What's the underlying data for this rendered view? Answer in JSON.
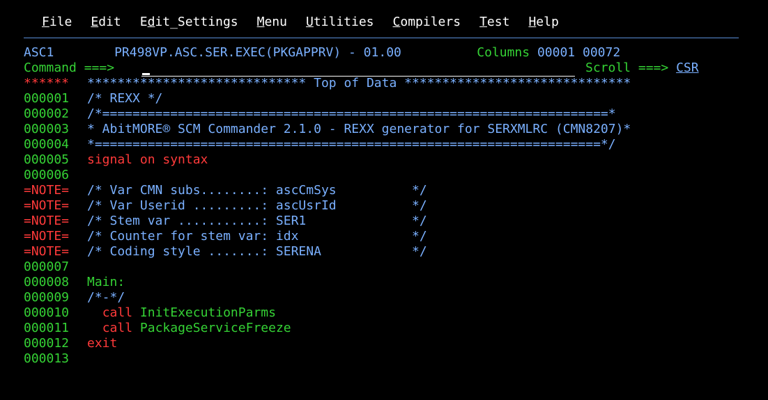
{
  "menu": {
    "items": [
      {
        "hot": "F",
        "rest": "ile"
      },
      {
        "hot": "E",
        "rest": "dit"
      },
      {
        "hot": "",
        "rest": "Edit_Settings",
        "hot_index": 1
      },
      {
        "hot": "M",
        "rest": "enu"
      },
      {
        "hot": "U",
        "rest": "tilities"
      },
      {
        "hot": "C",
        "rest": "ompilers"
      },
      {
        "hot": "T",
        "rest": "est"
      },
      {
        "hot": "H",
        "rest": "elp"
      }
    ],
    "labels": {
      "file_hot": "F",
      "file_rest": "ile",
      "edit_hot": "E",
      "edit_rest": "dit",
      "editset_pre": "E",
      "editset_hot": "d",
      "editset_rest": "it_Settings",
      "menu_hot": "M",
      "menu_rest": "enu",
      "util_hot": "U",
      "util_rest": "tilities",
      "comp_hot": "C",
      "comp_rest": "ompilers",
      "test_hot": "T",
      "test_rest": "est",
      "help_hot": "H",
      "help_rest": "elp"
    }
  },
  "header": {
    "mode": "ASC1",
    "dataset": "PR498VP.ASC.SER.EXEC(PKGAPPRV) - 01.00",
    "columns_label": "Columns",
    "columns_from": "00001",
    "columns_to": "00072",
    "command_label": "Command ===>",
    "command_value": "",
    "scroll_label": "Scroll ===>",
    "scroll_value": "CSR"
  },
  "editor": {
    "top_marker": "******",
    "top_line": "***************************** Top of Data ******************************",
    "lines": [
      {
        "num": "000001",
        "text": "/* REXX */",
        "color": "blue"
      },
      {
        "num": "000002",
        "text": "/*===================================================================*",
        "color": "blue"
      },
      {
        "num": "000003",
        "text": "* AbitMORE® SCM Commander 2.1.0 - REXX generator for SERXMLRC (CMN8207)*",
        "color": "blue"
      },
      {
        "num": "000004",
        "text": "*===================================================================*/",
        "color": "blue"
      },
      {
        "num": "000005",
        "text": "signal on syntax",
        "color": "red"
      },
      {
        "num": "000006",
        "text": "",
        "color": "blue"
      },
      {
        "num": "=NOTE=",
        "text": "/* Var CMN subs........: ascCmSys          */",
        "color": "blue"
      },
      {
        "num": "=NOTE=",
        "text": "/* Var Userid .........: ascUsrId          */",
        "color": "blue"
      },
      {
        "num": "=NOTE=",
        "text": "/* Stem var ...........: SER1              */",
        "color": "blue"
      },
      {
        "num": "=NOTE=",
        "text": "/* Counter for stem var: idx               */",
        "color": "blue"
      },
      {
        "num": "=NOTE=",
        "text": "/* Coding style .......: SERENA            */",
        "color": "blue"
      },
      {
        "num": "000007",
        "text": "",
        "color": "blue"
      },
      {
        "num": "000008",
        "text": "Main:",
        "color": "green"
      },
      {
        "num": "000009",
        "text": "/*-*/",
        "color": "blue"
      },
      {
        "num": "000010",
        "kw": "call",
        "arg": "InitExecutionParms",
        "indent": "  "
      },
      {
        "num": "000011",
        "kw": "call",
        "arg": "PackageServiceFreeze",
        "indent": "  "
      },
      {
        "num": "000012",
        "text": "exit",
        "color": "red"
      },
      {
        "num": "000013",
        "text": "",
        "color": "blue"
      }
    ]
  },
  "colors": {
    "background": "#000000",
    "sequence": "#35d235",
    "note": "#ff3a3a",
    "comment": "#7ab0ff",
    "keyword": "#ff3a3a",
    "menu_text": "#ffffff"
  }
}
